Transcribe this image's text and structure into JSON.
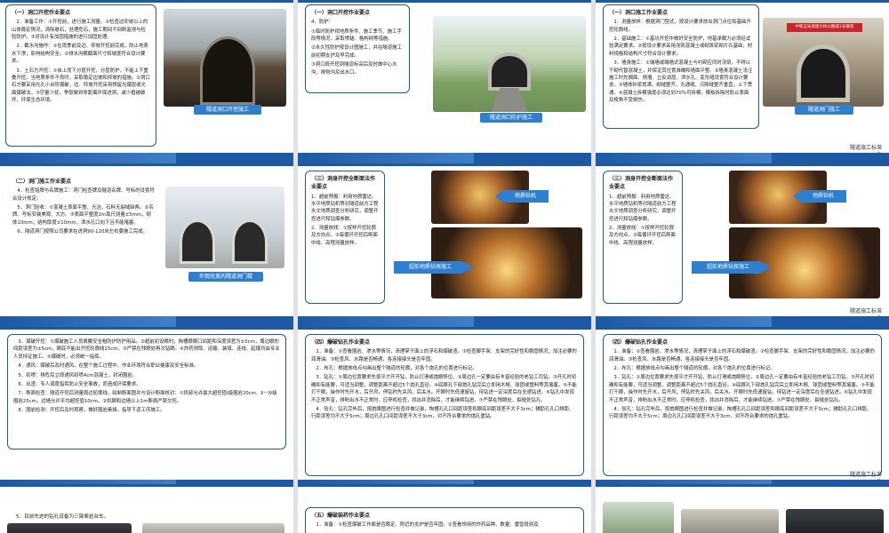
{
  "brand": {
    "line1": "隧道施工标准",
    "line2": "化"
  },
  "s1": {
    "heading": "（一）洞口开挖作业要点",
    "paras": [
      "1．准备工作：①开挖前，进行施工测量。②检查边仰坡以上的山体稳定情况，清除悬石，处理危石，施工期间不间断监测与检验防护。③对设计有加固措施的进行加固处理。",
      "2．截水沟施作：①在雨季前及边、仰坡开挖前完成，防止地表水下渗，影响结构安全。②排水沟横截面尺寸和坡度符合设计要求。",
      "3．土石方开挖：①自上而下分层开挖，分层防护，不能上下重叠开挖。当地质条件不良时，采取稳定边坡和抑坡的措施。②洞口石方要采用光孔小台阶爆破，边、仰坡开挖采用预留光爆层或光面爆破法。③尽量少扰，争取做到零距离环保进洞，减少植被破坏，环保生态环境。"
    ],
    "caption": "隧道洞口开挖施工"
  },
  "s2": {
    "heading": "（一）洞口开挖作业要点",
    "sub": "4．防护：",
    "paras": [
      "①临时防护视地质条件、施工季节、施工手段等情况，采取喷锚、格构网等措施。",
      "②永久性防护按设计图施工，并在隧道施工前初期支护及早完成。",
      "③洞口段开挖到隧道标高后及时做中心水沟、排侧沟及出水口。"
    ],
    "caption": "隧道洞口防护施工"
  },
  "s3": {
    "heading": "（一）洞口施工作业要点",
    "paras": [
      "1．测量放样：根据洞门型式，按设计要求放出洞门点位和基础开挖轮廓线。",
      "2．基础施工：①基坑开挖中做好安全防护，地基承载力必须经试验满足要求。②按设计要求采用浇筑混凝土或砌筑浆砌片石基础，材料规格和结构尺寸符合设计要求。",
      "3．墙身施工：①端墙或端墙式混凝土与衬砌应同时浇筑，不得以干砌代替混凝土，并保证其位置准确和墙面平整。②墙身混凝土浇注施工时先搁面、侧墙、立反滤层、泄水孔、变形缝设置符合设计要求。③墙体砂浆饱满，砌缝整齐，无通缝，沉降缝整齐垂直，上下贯通。④混凝土拆模强度必须达到70％可拆模，模板拆除时防止表面及棱角不受损伤。"
    ],
    "caption": "隧道洞门施工",
    "banner": "中铁五局承建大岭山隧道1号横洞"
  },
  "s4": {
    "heading": "（二）洞门施工作业要点",
    "paras": [
      "4．检查铭牌与名牌施工：洞门检查牌及隧道名牌、号标的设置符合设计规定。",
      "5．洞门验收：①混凝土表面平整、光洁，石料无裂缝缺角。②名牌、号标安装美观、大方。③表面平整度2m靠尺测量±5mm，砌体10mm；结构厚度±10mm，泄水孔口向下且不能堵塞。",
      "6．隧道洞门按照公司要求在进洞90-120米左右委施工完成。"
    ],
    "caption": "外观优美的隧道洞门楼"
  },
  "s5": {
    "heading": "（三）洞身开挖全断面法作业要点",
    "paras": [
      "1．超前预报：利用地质雷达、水平地质钻机等对隧道前方工程水文地质调查分析研究，调整开挖进尺和钻爆参数。",
      "2．测量放线：①按样开挖轮廓及方向点。②每循环开挖后断面中线、高程测量放样。"
    ],
    "label1": "地质钻机",
    "label2": "超前地质钻探施工"
  },
  "s6": {
    "heading": "（三）洞身开挖全断面法作业要点",
    "paras": [
      "1．超前预报：利用地质雷达、水平地质钻机等对隧道前方工程水文地质调查分析研究，调整开挖进尺和钻爆参数。",
      "2．测量放线：①按样开挖轮廓及方向点。②每循环开挖后断面中线、高程测量放样。"
    ],
    "label1": "地质钻机",
    "label2": "超前地质钻探施工"
  },
  "s7": {
    "paras": [
      "3．爆破开挖：①爆破施工人员佩戴安全帽防护防护用品。②超前初设眼时，掏槽眼眼口间距和深度误差为±5cm，周边眼的间距误差为±5cm，眼底不能出开挖轮廓线15cm。③严禁在残眼处再次钻眼。④炸药领取、运输、装填、连线、起爆均由专业人员持证施工。⑤爆破时，必须统一指挥。",
      "4．通风：爆破后及时通风，在整个施工过程中，作业环境符合职业健康及安全标准。",
      "5．初喷：排危后立即通风初喷4cm混凝土，封闭围岩。",
      "6．出渣：专人调度指挥防止安全事故，而造成环保要求。",
      "7．断面检查：隧道开挖后测量周边轮廓线，绘制断面图并与设计断面核对：①拱部允许最大超挖值Ⅰ级围岩20cm、Ⅱ－Ⅳ级围岩25cm，边墙允许平均超挖值10cm。②拱脚和边墙以上1m断面严禁欠挖。",
      "8．围岩检测：开挖后及时观察，做好围岩素描，指导下道工序施工。"
    ]
  },
  "s8": {
    "heading": "（四）爆破钻孔作业要点",
    "paras": [
      "1．准备：①查看围岩、渗水等情况，清理掌子面上的浮石和爆破渣。②检查脚手架、支架的完好性和稳固情况，加注必要的润滑油。③检查风、水路是否畅通，各连接接头是否牢固。",
      "2．布孔：根据放线点勾画出整个隧道的轮廓，对各个炮孔的位置进行标记。",
      "3．钻孔：①周边位置要求先按平才开开钻，防止打滑或炮眼移位。②周边孔一定要由有丰富经验的老钻工司钻。③开孔时初确和有能要，可适当调整，调整距离不超过5个炮孔直径。④底眼孔下部炮孔钻完后立即用木棍、球团或塑料等其堵塞。⑤不能打干眼，操作时先开水，后开风，停钻时先关风，后关水。开眼时先低速旋钻，待钻进一定深度后在全速钻进。⑥钻孔中发现不正常声音，排粉出水不正常时，应停机检查，找出并消除后，才能继续钻进。⑦严禁在残眼处、裂缝处钻孔。",
      "4．验孔：钻孔完毕后，按炮眼图进行检查并做记录，掏槽孔孔口间距误差和眼底间距误差不大于3cm；辅助孔孔口排距、行距误差均不大于5cm；周边孔孔口间距误差不大于3cm，对不符合要求的炮孔重钻。"
    ]
  },
  "s9": {
    "heading": "（四）爆破钻孔作业要点",
    "paras": [
      "1．准备：①查看围岩、渗水等情况，清理掌子面上的浮石和爆破渣。②检查脚手架、支架的完好性和稳固情况，加注必要的润滑油。③检查风、水路是否畅通，各连接接头是否牢固。",
      "2．布孔：根据放线点勾画出整个隧道的轮廓，对各个炮孔的位置进行标记。",
      "3．钻孔：①周边位置要求先按平才开开钻，防止打滑或炮眼移位。②周边孔一定要由有丰富经验的老钻工司钻。③开孔时初确和有能要，可适当调整，调整距离不超过5个炮孔直径。④底眼孔下部炮孔钻完后立即用木棍、球团或塑料等其堵塞。⑤不能打干眼，操作时先开水，后开风，停钻时先关风，后关水。开眼时先低速旋钻，待钻进一定深度后在全速钻进。⑥钻孔中发现不正常声音，排粉出水不正常时，应停机检查，找出并消除后，才能继续钻进。⑦严禁在残眼处、裂缝处钻孔。",
      "4．验孔：钻孔完毕后，按炮眼图进行检查并做记录，掏槽孔孔口间距误差和眼底间距误差不大于3cm；辅助孔孔口排距、行距误差均不大于5cm；周边孔孔口间距误差不大于3cm，对不符合要求的炮孔重钻。"
    ]
  },
  "s10": {
    "para": "5．目前先进的钻孔设备为三臂凿岩台车。"
  },
  "s11": {
    "heading": "（五）爆破装药作业要点",
    "para": "1．准备：①检查爆破工作面是否稳定、附近的支护是否牢固。②查看领用的炸药品种、数量、雷管段别及"
  }
}
